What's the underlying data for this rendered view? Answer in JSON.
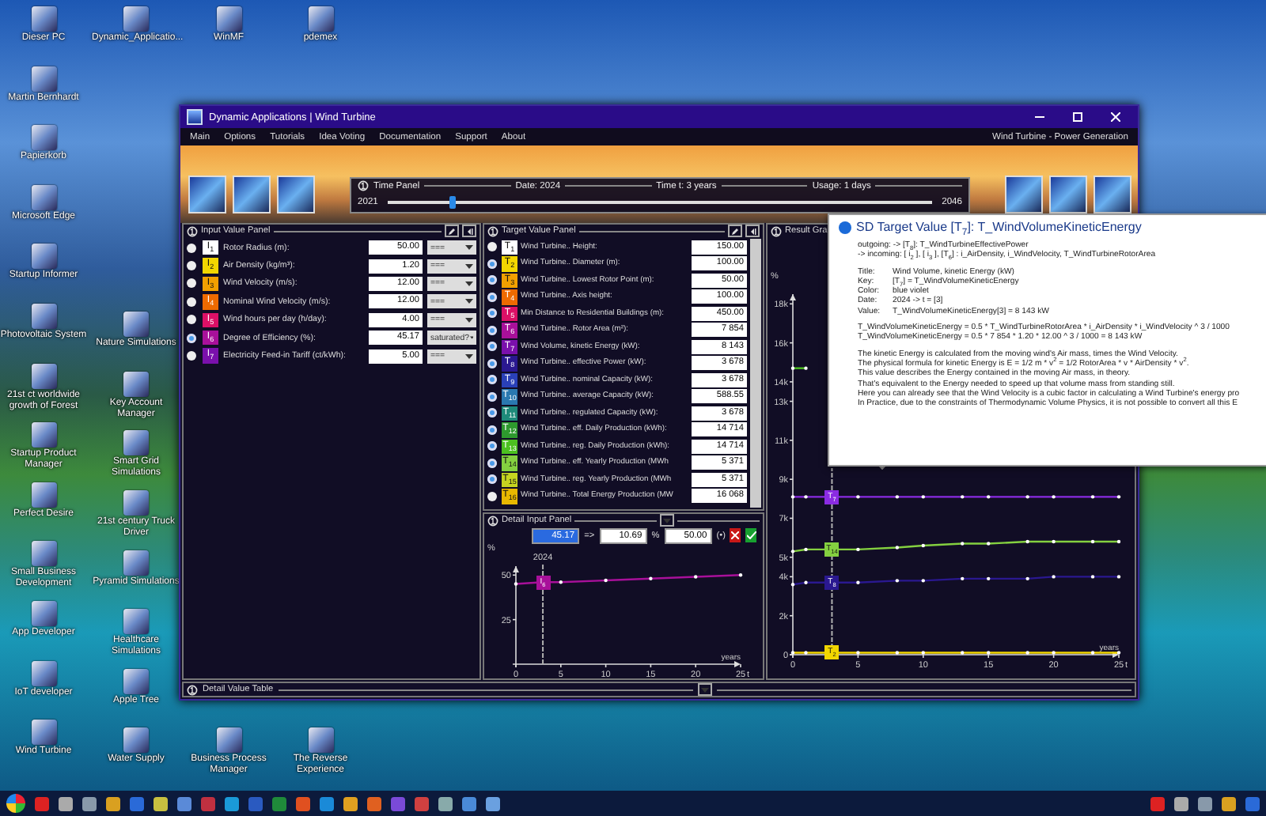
{
  "desktop": {
    "columns": [
      {
        "top": [
          {
            "label": "Dieser PC"
          },
          {
            "label": "Martin Bernhardt"
          },
          {
            "label": "Papierkorb"
          },
          {
            "label": "Microsoft Edge"
          },
          {
            "label": "Startup Informer"
          },
          {
            "label": "Photovoltaic System"
          },
          {
            "label": "21st ct worldwide growth of Forest"
          },
          {
            "label": "Startup Product Manager"
          },
          {
            "label": "Perfect Desire"
          },
          {
            "label": "Small Business Development"
          },
          {
            "label": "App Developer"
          },
          {
            "label": "IoT developer"
          },
          {
            "label": "Wind Turbine"
          }
        ]
      },
      {
        "top": [
          {
            "label": "Dynamic_Applicatio..."
          }
        ],
        "bottom": [
          {
            "label": "Nature Simulations"
          },
          {
            "label": "Key Account Manager"
          },
          {
            "label": "Smart Grid Simulations"
          },
          {
            "label": "21st century Truck Driver"
          },
          {
            "label": "Pyramid Simulations"
          },
          {
            "label": "Healthcare Simulations"
          },
          {
            "label": "Apple Tree"
          },
          {
            "label": "Water Supply"
          }
        ]
      },
      {
        "top": [
          {
            "label": "WinMF"
          }
        ],
        "bottom": [
          {
            "label": "Business Process Manager"
          }
        ]
      },
      {
        "top": [
          {
            "label": "pdemex"
          }
        ],
        "bottom": [
          {
            "label": "The Reverse Experience"
          }
        ]
      }
    ]
  },
  "window": {
    "title": "Dynamic Applications | Wind Turbine",
    "menu": [
      "Main",
      "Options",
      "Tutorials",
      "Idea Voting",
      "Documentation",
      "Support",
      "About"
    ],
    "menu_right": "Wind Turbine - Power Generation"
  },
  "time_panel": {
    "title": "Time Panel",
    "date": "Date: 2024",
    "time": "Time t: 3 years",
    "usage": "Usage: 1 days",
    "start": "2021",
    "end": "2046",
    "level": 0.12
  },
  "input_panel": {
    "title": "Input Value Panel",
    "rows": [
      {
        "icon": "I$_{1}$",
        "label": "Rotor Radius (m):",
        "value": "50.00",
        "option": "===",
        "selected": false,
        "color": "#ffffff"
      },
      {
        "icon": "I$_{2}$",
        "label": "Air Density (kg/m³):",
        "value": "1.20",
        "option": "===",
        "selected": false,
        "color": "#f2d600"
      },
      {
        "icon": "I$_{3}$",
        "label": "Wind Velocity (m/s):",
        "value": "12.00",
        "option": "===",
        "selected": false,
        "color": "#f2a000"
      },
      {
        "icon": "I$_{4}$",
        "label": "Nominal Wind Velocity (m/s):",
        "value": "12.00",
        "option": "===",
        "selected": false,
        "color": "#ee6a00"
      },
      {
        "icon": "I$_{5}$",
        "label": "Wind hours per day (h/day):",
        "value": "4.00",
        "option": "===",
        "selected": false,
        "color": "#dc1066"
      },
      {
        "icon": "I$_{6}$",
        "label": "Degree of Efficiency (%):",
        "value": "45.17",
        "option": "saturated?",
        "selected": true,
        "color": "#a8109a"
      },
      {
        "icon": "I$_{7}$",
        "label": "Electricity Feed-in Tariff (ct/kWh):",
        "value": "5.00",
        "option": "===",
        "selected": false,
        "color": "#7a10ac"
      }
    ]
  },
  "target_panel": {
    "title": "Target Value Panel",
    "rows": [
      {
        "icon": "T$_{1}$",
        "label": "Wind Turbine.. Height:",
        "value": "150.00",
        "checked": false,
        "color": "#ffffff"
      },
      {
        "icon": "T$_{2}$",
        "label": "Wind Turbine.. Diameter (m):",
        "value": "100.00",
        "checked": true,
        "color": "#f2d600"
      },
      {
        "icon": "T$_{3}$",
        "label": "Wind Turbine.. Lowest Rotor Point (m):",
        "value": "50.00",
        "checked": true,
        "color": "#f2a000"
      },
      {
        "icon": "T$_{4}$",
        "label": "Wind Turbine.. Axis height:",
        "value": "100.00",
        "checked": true,
        "color": "#ee6a00"
      },
      {
        "icon": "T$_{5}$",
        "label": "Min Distance to Residential Buildings (m):",
        "value": "450.00",
        "checked": true,
        "color": "#dc1066"
      },
      {
        "icon": "T$_{6}$",
        "label": "Wind Turbine.. Rotor Area (m²):",
        "value": "7 854",
        "checked": true,
        "color": "#a8109a"
      },
      {
        "icon": "T$_{7}$",
        "label": "Wind Volume, kinetic Energy (kW):",
        "value": "8 143",
        "checked": true,
        "color": "#7a10ac"
      },
      {
        "icon": "T$_{8}$",
        "label": "Wind Turbine.. effective Power (kW):",
        "value": "3 678",
        "checked": true,
        "color": "#2a1890"
      },
      {
        "icon": "T$_{9}$",
        "label": "Wind Turbine.. nominal Capacity (kW):",
        "value": "3 678",
        "checked": true,
        "color": "#2a40b8"
      },
      {
        "icon": "T$_{10}$",
        "label": "Wind Turbine.. average Capacity (kW):",
        "value": "588.55",
        "checked": true,
        "color": "#2a78b0"
      },
      {
        "icon": "T$_{11}$",
        "label": "Wind Turbine.. regulated Capacity (kW):",
        "value": "3 678",
        "checked": true,
        "color": "#1e8a7a"
      },
      {
        "icon": "T$_{12}$",
        "label": "Wind Turbine.. eff. Daily Production (kWh):",
        "value": "14 714",
        "checked": true,
        "color": "#2e9a2e"
      },
      {
        "icon": "T$_{13}$",
        "label": "Wind Turbine.. reg. Daily Production (kWh):",
        "value": "14 714",
        "checked": true,
        "color": "#4cc020"
      },
      {
        "icon": "T$_{14}$",
        "label": "Wind Turbine.. eff. Yearly Production (MWh",
        "value": "5 371",
        "checked": true,
        "color": "#84d040"
      },
      {
        "icon": "T$_{15}$",
        "label": "Wind Turbine.. reg. Yearly Production (MWh",
        "value": "5 371",
        "checked": true,
        "color": "#c6d420"
      },
      {
        "icon": "T$_{16}$",
        "label": "Wind Turbine.. Total Energy Production (MW",
        "value": "16 068",
        "checked": false,
        "color": "#e8b800"
      }
    ]
  },
  "detail_input": {
    "title": "Detail Input Panel",
    "value": "45.17",
    "arrow": "=>",
    "result": "10.69",
    "unit": "%",
    "target": "50.00",
    "target_mode": "(•)",
    "axis_end": "t",
    "chart_data": {
      "type": "line",
      "ylabel": "%",
      "xlabel": "years",
      "x": [
        0,
        3,
        5,
        10,
        15,
        20,
        25
      ],
      "xlim": [
        0,
        25
      ],
      "ylim": [
        0,
        55
      ],
      "xticks": [
        0,
        5,
        10,
        15,
        20,
        25
      ],
      "yticks": [
        25,
        50
      ],
      "annotations": [
        {
          "x": 3,
          "text": "2024"
        }
      ],
      "series": [
        {
          "name": "I$_{6}$",
          "color": "#a8109a",
          "values": [
            45,
            46,
            46,
            47,
            48,
            49,
            50
          ]
        }
      ]
    }
  },
  "result_graph": {
    "title": "Result Gra",
    "axis_end": "t",
    "chart_data": {
      "type": "line",
      "ylabel": "%",
      "xlabel": "years",
      "x": [
        0,
        1,
        3,
        5,
        8,
        10,
        13,
        15,
        18,
        20,
        23,
        25
      ],
      "xlim": [
        0,
        25
      ],
      "ylim": [
        0,
        18500
      ],
      "xticks": [
        0,
        5,
        10,
        15,
        20,
        25
      ],
      "ref_lines": [
        {
          "axis": "x",
          "value": 3
        }
      ],
      "yticks": [
        0,
        {
          "value": 2000,
          "label": "2k"
        },
        {
          "value": 4000,
          "label": "4k"
        },
        {
          "value": 5000,
          "label": "5k"
        },
        {
          "value": 7000,
          "label": "7k"
        },
        {
          "value": 9000,
          "label": "9k"
        },
        {
          "value": 11000,
          "label": "11k"
        },
        {
          "value": 13000,
          "label": "13k"
        },
        {
          "value": 14000,
          "label": "14k"
        },
        {
          "value": 16000,
          "label": "16k"
        },
        {
          "value": 18000,
          "label": "18k"
        }
      ],
      "series": [
        {
          "color": "#4cc020",
          "values": [
            14700,
            14700,
            null,
            null,
            null,
            null,
            null,
            null,
            null,
            null,
            null,
            null
          ]
        },
        {
          "name": "T$_{7}$",
          "color": "#8a2be2",
          "values": [
            8100,
            8100,
            8100,
            8100,
            8100,
            8100,
            8100,
            8100,
            8100,
            8100,
            8100,
            8100
          ]
        },
        {
          "name": "T$_{14}$",
          "color": "#84d040",
          "values": [
            5300,
            5400,
            5400,
            5400,
            5500,
            5600,
            5700,
            5700,
            5800,
            5800,
            5800,
            5800
          ]
        },
        {
          "name": "T$_{8}$",
          "color": "#2a1890",
          "values": [
            3600,
            3700,
            3700,
            3700,
            3800,
            3800,
            3900,
            3900,
            3900,
            4000,
            4000,
            4000
          ]
        },
        {
          "name": "T$_{2}$",
          "color": "#f2d600",
          "values": [
            100,
            100,
            100,
            100,
            100,
            100,
            100,
            100,
            100,
            100,
            100,
            100
          ]
        }
      ]
    }
  },
  "detail_table": {
    "title": "Detail Value Table"
  },
  "tooltip": {
    "title": "SD Target Value  [T$_{7}$]:  T_WindVolumeKineticEnergy",
    "links": [
      "outgoing:  -> [T$_{8}$]:  T_WindTurbineEffectivePower",
      "-> incoming:  [ i$_{2}$ ], [ i$_{3}$ ], [T$_{6}$] :  i_AirDensity,  i_WindVelocity,  T_WindTurbineRotorArea"
    ],
    "fields": [
      {
        "key": "Title:",
        "value": "Wind Volume, kinetic Energy (kW)"
      },
      {
        "key": "Key:",
        "value": "[T$_{7}$] = T_WindVolumeKineticEnergy"
      },
      {
        "key": "Color:",
        "value": "blue violet"
      },
      {
        "key": "Date:",
        "value": "2024  ->  t = [3]"
      },
      {
        "key": "Value:",
        "value": "T_WindVolumeKineticEnergy[3] = 8 143 kW"
      }
    ],
    "formulas": [
      "T_WindVolumeKineticEnergy  =  0.5 * T_WindTurbineRotorArea * i_AirDensity * i_WindVelocity ^ 3 / 1000",
      "T_WindVolumeKineticEnergy  =  0.5 * 7 854 * 1.20 * 12.00 ^ 3 / 1000  =  8 143  kW"
    ],
    "description": [
      "The kinetic Energy is calculated from the moving wind's Air mass, times the Wind Velocity.",
      "The physical formula for kinetic Energy is E = 1/2 m * v$^{2}$  =  1/2 RotorArea * v * AirDensity * v$^{2}$.",
      "This value describes the Energy contained in the moving Air mass, in theory.",
      "That's equivalent to the Energy needed to speed up that volume mass from standing still.",
      "Here you can already see that the Wind Velocity is a cubic factor in calculating a Wind Turbine's energy pro",
      "In Practice, due to the constraints of Thermodynamic Volume Physics, it is not possible to convert all this E"
    ]
  }
}
